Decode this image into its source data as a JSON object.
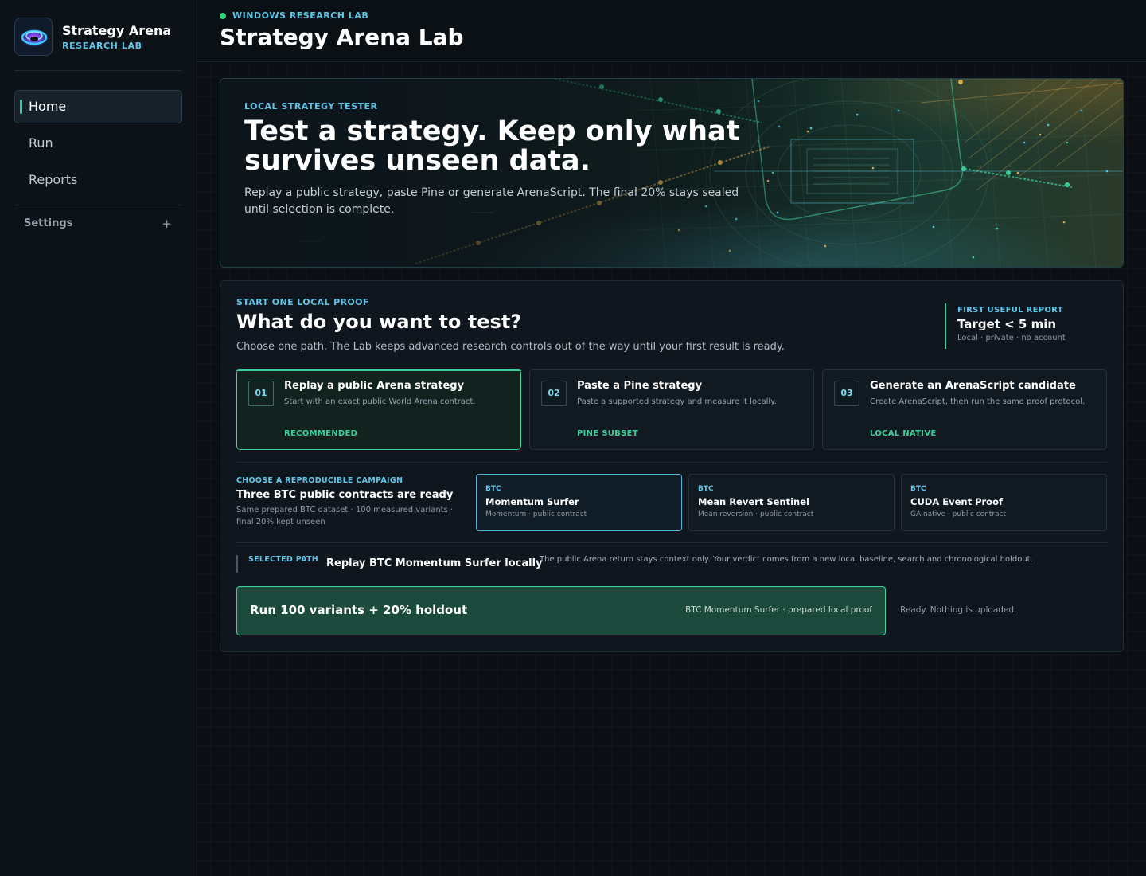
{
  "colors": {
    "background": "#0b0f14",
    "sidebar": "#0d1218",
    "accent_green": "#3ccf9c",
    "accent_cyan": "#5fc6e8",
    "status_dot": "#33d17a",
    "run_button": "#1c4a3c"
  },
  "brand": {
    "name": "Strategy Arena",
    "subtitle": "RESEARCH LAB",
    "logo_icon": "arena-logo-icon"
  },
  "nav": {
    "items": [
      {
        "label": "Home",
        "active": true
      },
      {
        "label": "Run",
        "active": false
      },
      {
        "label": "Reports",
        "active": false
      }
    ],
    "settings_label": "Settings",
    "settings_toggle": "+"
  },
  "header": {
    "eyebrow": "WINDOWS RESEARCH LAB",
    "title": "Strategy Arena Lab"
  },
  "hero": {
    "eyebrow": "LOCAL STRATEGY TESTER",
    "title": "Test a strategy. Keep only what survives unseen data.",
    "description": "Replay a public strategy, paste Pine or generate ArenaScript. The final 20% stays sealed until selection is complete."
  },
  "start": {
    "eyebrow": "START ONE LOCAL PROOF",
    "title": "What do you want to test?",
    "description": "Choose one path. The Lab keeps advanced research controls out of the way until your first result is ready.",
    "target": {
      "label": "FIRST USEFUL REPORT",
      "value": "Target < 5 min",
      "sub": "Local · private · no account"
    },
    "paths": [
      {
        "num": "01",
        "title": "Replay a public Arena strategy",
        "desc": "Start with an exact public World Arena contract.",
        "tag": "RECOMMENDED",
        "selected": true
      },
      {
        "num": "02",
        "title": "Paste a Pine strategy",
        "desc": "Paste a supported strategy and measure it locally.",
        "tag": "PINE SUBSET",
        "selected": false
      },
      {
        "num": "03",
        "title": "Generate an ArenaScript candidate",
        "desc": "Create ArenaScript, then run the same proof protocol.",
        "tag": "LOCAL NATIVE",
        "selected": false
      }
    ]
  },
  "campaign": {
    "eyebrow": "CHOOSE A REPRODUCIBLE CAMPAIGN",
    "title": "Three BTC public contracts are ready",
    "description": "Same prepared BTC dataset · 100 measured variants · final 20% kept unseen",
    "contracts": [
      {
        "tag": "BTC",
        "name": "Momentum Surfer",
        "desc": "Momentum · public contract",
        "selected": true
      },
      {
        "tag": "BTC",
        "name": "Mean Revert Sentinel",
        "desc": "Mean reversion · public contract",
        "selected": false
      },
      {
        "tag": "BTC",
        "name": "CUDA Event Proof",
        "desc": "GA native · public contract",
        "selected": false
      }
    ]
  },
  "selection": {
    "label": "SELECTED PATH",
    "value": "Replay BTC Momentum Surfer locally",
    "note": "The public Arena return stays context only. Your verdict comes from a new local baseline, search and chronological holdout."
  },
  "run": {
    "label": "Run 100 variants + 20% holdout",
    "meta": "BTC Momentum Surfer · prepared local proof",
    "status": "Ready. Nothing is uploaded."
  }
}
